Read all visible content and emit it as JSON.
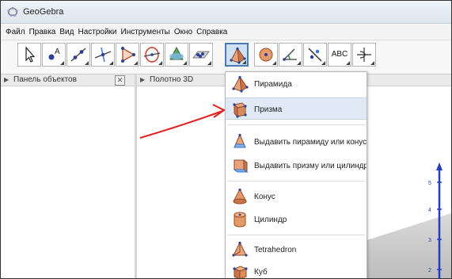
{
  "window": {
    "title": "GeoGebra"
  },
  "menu": [
    "Файл",
    "Правка",
    "Вид",
    "Настройки",
    "Инструменты",
    "Окно",
    "Справка"
  ],
  "toolbar": {
    "text_tool_label": "ABC",
    "tools": [
      "move-tool",
      "point-tool",
      "line-tool",
      "perpendicular-tool",
      "polygon-tool",
      "circle-axis-tool",
      "intersect-surfaces-tool",
      "plane-tool",
      "pyramid-tool",
      "sphere-tool",
      "angle-tool",
      "reflect-tool",
      "text-tool",
      "rotate-view-tool"
    ],
    "active_tool": "pyramid-tool"
  },
  "panels": {
    "objects_title": "Панель объектов",
    "close_glyph": "✕",
    "graphics_title": "Полотно 3D"
  },
  "dropdown": {
    "items": [
      "Пирамида",
      "Призма",
      "Выдавить пирамиду или конус",
      "Выдавить призму или цилиндр",
      "Конус",
      "Цилиндр",
      "Tetrahedron",
      "Куб"
    ],
    "highlighted_item": "Призма"
  },
  "axis_ticks": [
    "5",
    "4",
    "3",
    "2"
  ],
  "colors": {
    "accent": "#4b79b0",
    "highlight": "#dfeaf6",
    "axis": "#1f3fbf",
    "annotation_arrow": "#e02020"
  }
}
